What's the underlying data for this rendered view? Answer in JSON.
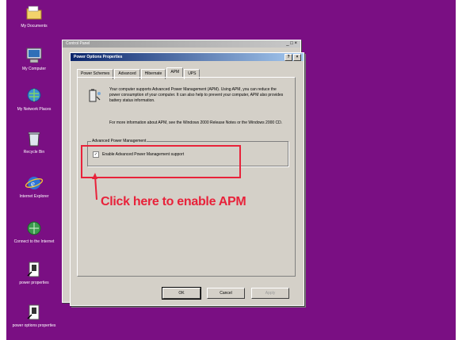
{
  "desktop": {
    "background": "#7a0f83",
    "icons": [
      {
        "label": "My Documents",
        "icon": "folder-icon"
      },
      {
        "label": "My Computer",
        "icon": "computer-icon"
      },
      {
        "label": "My Network Places",
        "icon": "network-icon"
      },
      {
        "label": "Recycle Bin",
        "icon": "recycle-bin-icon"
      },
      {
        "label": "Internet Explorer",
        "icon": "internet-explorer-icon"
      },
      {
        "label": "Connect to the Internet",
        "icon": "connect-icon"
      },
      {
        "label": "power properties",
        "icon": "shortcut-icon"
      },
      {
        "label": "power options properties",
        "icon": "shortcut-icon"
      }
    ]
  },
  "back_window": {
    "title": "Control Panel"
  },
  "dialog": {
    "title": "Power Options Properties",
    "controls": {
      "help": "?",
      "close": "×"
    },
    "tabs": [
      "Power Schemes",
      "Advanced",
      "Hibernate",
      "APM",
      "UPS"
    ],
    "active_tab": "APM",
    "description": "Your computer supports Advanced Power Management (APM). Using APM, you can reduce the power consumption of your computer. It can also help to prevent your computer, APM also provides battery status information.",
    "more_info": "For more information about APM, see the Windows 2000 Release Notes or the Windows 2000 CD.",
    "apm_group": {
      "label": "Advanced Power Management",
      "checkbox_label": "Enable Advanced Power Management support",
      "checked": true,
      "check_glyph": "✓"
    },
    "buttons": {
      "ok": "OK",
      "cancel": "Cancel",
      "apply": "Apply"
    }
  },
  "annotation": {
    "text": "Click here to enable APM",
    "color": "#e8223a"
  }
}
